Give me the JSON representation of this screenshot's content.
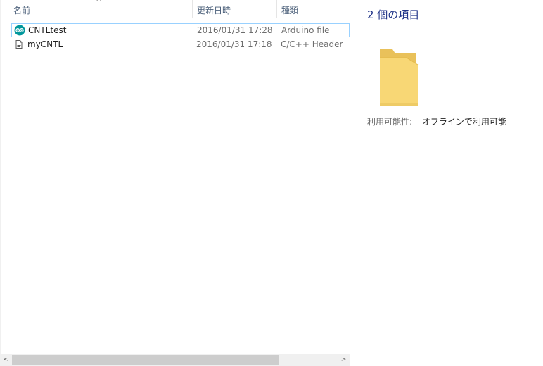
{
  "list": {
    "columns": {
      "name": "名前",
      "modified": "更新日時",
      "type": "種類"
    },
    "sort_indicator": "^",
    "files": [
      {
        "name": "CNTLtest",
        "modified": "2016/01/31 17:28",
        "type": "Arduino file",
        "icon": "arduino-icon",
        "selected": true
      },
      {
        "name": "myCNTL",
        "modified": "2016/01/31 17:18",
        "type": "C/C++ Header",
        "icon": "header-file-icon",
        "selected": false
      }
    ]
  },
  "scrollbar": {
    "left_arrow": "<",
    "right_arrow": ">"
  },
  "details": {
    "item_count": "2 個の項目",
    "icon": "folder-icon",
    "availability_label": "利用可能性:",
    "availability_value": "オフラインで利用可能"
  },
  "colors": {
    "selection_border": "#99d1ff",
    "header_text": "#4c607a",
    "count_text": "#1e3287",
    "arduino_teal": "#00979c",
    "folder_yellow": "#f8d775"
  }
}
